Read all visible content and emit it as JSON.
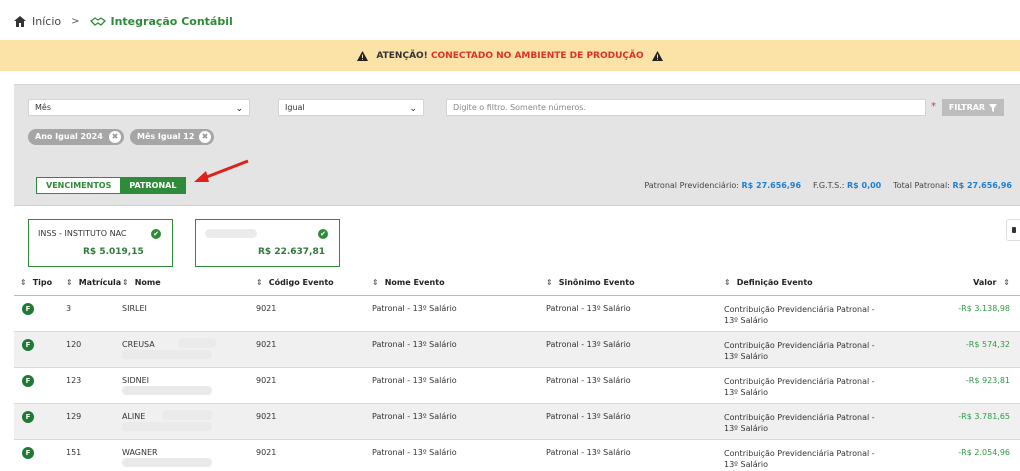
{
  "breadcrumb": {
    "home": "Início",
    "separator": ">",
    "current": "Integração Contábil"
  },
  "alert": {
    "prefix": "ATENÇÃO!",
    "message": "CONECTADO NO AMBIENTE DE PRODUÇÃO"
  },
  "filters": {
    "field_select": "Mês",
    "operator_select": "Igual",
    "input_placeholder": "Digite o filtro. Somente números.",
    "filter_button": "FILTRAR",
    "chips": [
      "Ano Igual 2024",
      "Mês Igual 12"
    ]
  },
  "tabs": [
    {
      "label": "VENCIMENTOS",
      "active": false
    },
    {
      "label": "PATRONAL",
      "active": true
    }
  ],
  "totals": {
    "prev_label": "Patronal Previdenciário:",
    "prev_value": "R$ 27.656,96",
    "fgts_label": "F.G.T.S.:",
    "fgts_value": "R$ 0,00",
    "total_label": "Total Patronal:",
    "total_value": "R$ 27.656,96"
  },
  "cards": [
    {
      "title": "INSS - INSTITUTO NAC",
      "amount": "R$ 5.019,15"
    },
    {
      "title": "",
      "amount": "R$ 22.637,81"
    }
  ],
  "table": {
    "headers": {
      "tipo": "Tipo",
      "matricula": "Matrícula",
      "nome": "Nome",
      "codigo": "Código Evento",
      "nome_evento": "Nome Evento",
      "sinonimo": "Sinônimo Evento",
      "definicao": "Definição Evento",
      "valor": "Valor"
    },
    "rows": [
      {
        "tipo": "F",
        "matricula": "3",
        "nome": "SIRLEI",
        "codigo": "9021",
        "nome_evento": "Patronal - 13º Salário",
        "sinonimo": "Patronal - 13º Salário",
        "definicao_1": "Contribuição Previdenciária Patronal -",
        "definicao_2": "13º Salário",
        "valor": "-R$ 3.138,98"
      },
      {
        "tipo": "F",
        "matricula": "120",
        "nome": "CREUSA",
        "codigo": "9021",
        "nome_evento": "Patronal - 13º Salário",
        "sinonimo": "Patronal - 13º Salário",
        "definicao_1": "Contribuição Previdenciária Patronal -",
        "definicao_2": "13º Salário",
        "valor": "-R$ 574,32"
      },
      {
        "tipo": "F",
        "matricula": "123",
        "nome": "SIDNEI",
        "codigo": "9021",
        "nome_evento": "Patronal - 13º Salário",
        "sinonimo": "Patronal - 13º Salário",
        "definicao_1": "Contribuição Previdenciária Patronal -",
        "definicao_2": "13º Salário",
        "valor": "-R$ 923,81"
      },
      {
        "tipo": "F",
        "matricula": "129",
        "nome": "ALINE",
        "codigo": "9021",
        "nome_evento": "Patronal - 13º Salário",
        "sinonimo": "Patronal - 13º Salário",
        "definicao_1": "Contribuição Previdenciária Patronal -",
        "definicao_2": "13º Salário",
        "valor": "-R$ 3.781,65"
      },
      {
        "tipo": "F",
        "matricula": "151",
        "nome": "WAGNER",
        "codigo": "9021",
        "nome_evento": "Patronal - 13º Salário",
        "sinonimo": "Patronal - 13º Salário",
        "definicao_1": "Contribuição Previdenciária Patronal -",
        "definicao_2": "13º Salário",
        "valor": "-R$ 2.054,96"
      }
    ]
  },
  "colors": {
    "brand_green": "#2e8b3a",
    "alert_bg": "#fbe3a7",
    "alert_red": "#e0302b",
    "link_blue": "#1e7fd1"
  }
}
